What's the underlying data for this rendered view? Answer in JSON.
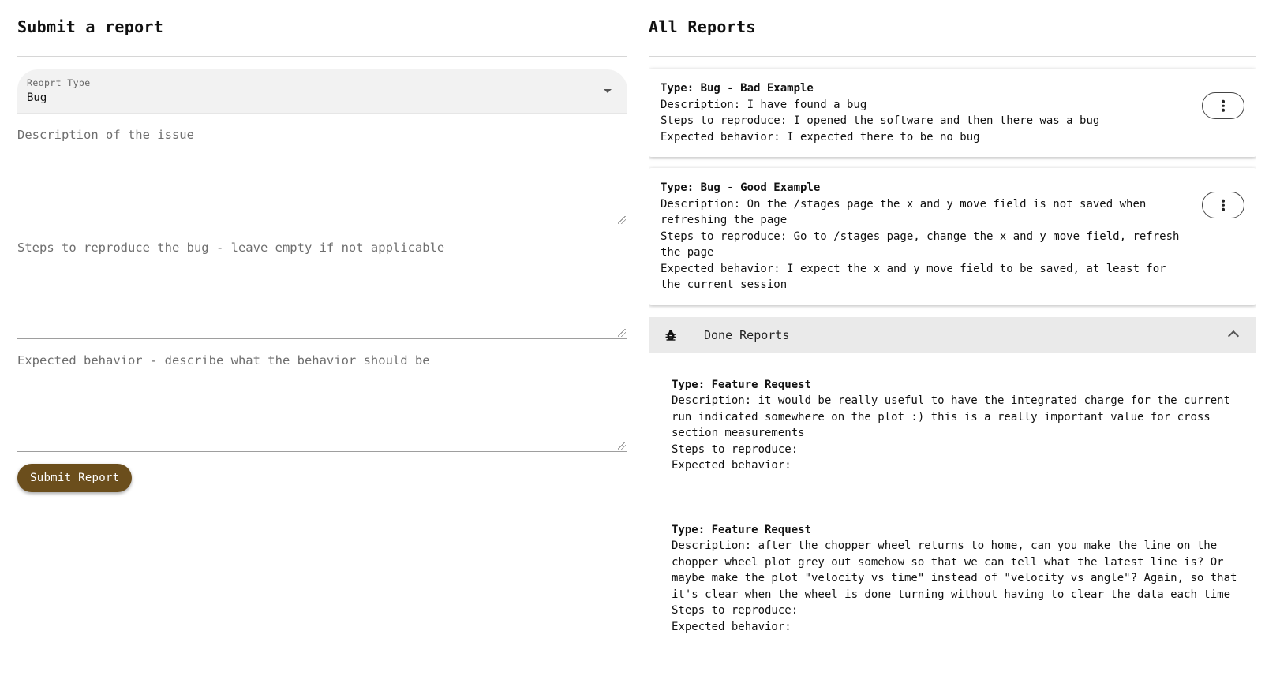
{
  "submit_form": {
    "title": "Submit a report",
    "report_type": {
      "label": "Reoprt Type",
      "value": "Bug"
    },
    "description_placeholder": "Description of the issue",
    "steps_placeholder": "Steps to reproduce the bug - leave empty if not applicable",
    "expected_placeholder": "Expected behavior - describe what the behavior should be",
    "submit_label": "Submit Report"
  },
  "reports": {
    "title": "All Reports",
    "items": [
      {
        "type": "Type: Bug - Bad Example",
        "description": "Description: I have found a bug",
        "steps": "Steps to reproduce: I opened the software and then there was a bug",
        "expected": "Expected behavior: I expected there to be no bug"
      },
      {
        "type": "Type: Bug - Good Example",
        "description": "Description: On the /stages page the x and y move field is not saved when refreshing the page",
        "steps": "Steps to reproduce: Go to /stages page, change the x and y move field, refresh the page",
        "expected": "Expected behavior: I expect the x and y move field to be saved, at least for the current session"
      }
    ],
    "done": {
      "title": "Done Reports",
      "icon": "bug-icon",
      "items": [
        {
          "type": "Type: Feature Request",
          "description": "Description: it would be really useful to have the integrated charge for the current run indicated somewhere on the plot :) this is a really important value for cross section measurements",
          "steps": "Steps to reproduce:",
          "expected": "Expected behavior:"
        },
        {
          "type": "Type: Feature Request",
          "description": "Description: after the chopper wheel returns to home, can you make the line on the chopper wheel plot grey out somehow so that we can tell what the latest line is? Or maybe make the plot \"velocity vs time\" instead of \"velocity vs angle\"? Again, so that it's clear when the wheel is done turning without having to clear the data each time",
          "steps": "Steps to reproduce:",
          "expected": "Expected behavior:"
        }
      ]
    }
  },
  "colors": {
    "accent": "#6b4e1c",
    "field_bg": "#f2f2f2",
    "done_header_bg": "#eaeaea"
  }
}
